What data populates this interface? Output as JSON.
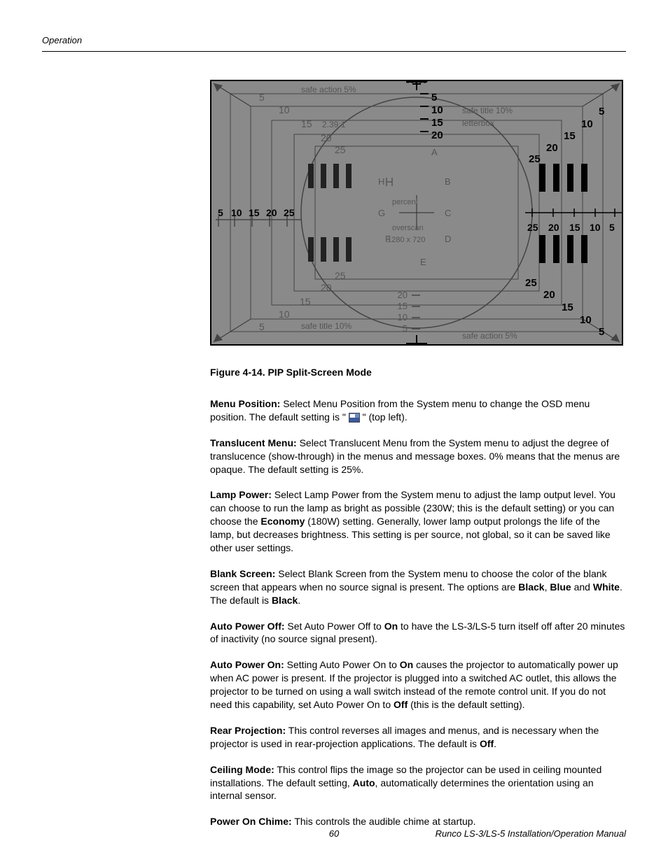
{
  "header": {
    "section": "Operation"
  },
  "figure": {
    "caption": "Figure 4-14. PIP Split-Screen Mode",
    "pattern": {
      "labels": {
        "safe_action": "safe action 5%",
        "safe_title": "safe title 10%",
        "aspect": "2.39:1",
        "letterbox": "letterbox",
        "percent": "percent",
        "overscan": "overscan",
        "resolution": "1280 x 720"
      },
      "scale": [
        "5",
        "10",
        "15",
        "20",
        "25"
      ],
      "grid_letters": [
        "A",
        "B",
        "C",
        "D",
        "E",
        "F",
        "G",
        "H"
      ]
    }
  },
  "sections": {
    "menu_position": {
      "title": "Menu Position:",
      "p1": " Select Menu Position from the System menu to change the OSD menu position. The default setting is \" ",
      "p2": " \" (top left)."
    },
    "translucent_menu": {
      "title": "Translucent Menu:",
      "text": " Select Translucent Menu from the System menu to adjust the degree of translucence (show-through) in the menus and message boxes. 0% means that the menus are opaque. The default setting is 25%."
    },
    "lamp_power": {
      "title": "Lamp Power:",
      "p1": " Select Lamp Power from the System menu to adjust the lamp output level. You can choose to run the lamp as bright as possible (230W; this is the default setting) or you can choose the ",
      "economy": "Economy",
      "p2": " (180W) setting. Generally, lower lamp output prolongs the life of the lamp, but decreases brightness. This setting is per source, not global, so it can be saved like other user settings."
    },
    "blank_screen": {
      "title": "Blank Screen:",
      "p1": " Select Blank Screen from the System menu to choose the color of the blank screen that appears when no source signal is present. The options are ",
      "opt1": "Black",
      "sep1": ", ",
      "opt2": "Blue",
      "p2": " and ",
      "opt3": "White",
      "p3": ". The default is ",
      "opt4": "Black",
      "p4": "."
    },
    "auto_power_off": {
      "title": "Auto Power Off:",
      "p1": " Set Auto Power Off to ",
      "on": "On",
      "p2": " to have the LS-3/LS-5 turn itself off after 20 minutes of inactivity (no source signal present)."
    },
    "auto_power_on": {
      "title": "Auto Power On:",
      "p1": " Setting Auto Power On to ",
      "on": "On",
      "p2": " causes the projector to automatically power up when AC power is present. If the projector is plugged into a switched AC outlet, this allows the projector to be turned on using a wall switch instead of the remote control unit. If you do not need this capability, set Auto Power On to ",
      "off": "Off",
      "p3": " (this is the default setting)."
    },
    "rear_projection": {
      "title": "Rear Projection:",
      "p1": " This control reverses all images and menus, and is necessary when the projector is used in rear-projection applications.  The default is ",
      "off": "Off",
      "p2": "."
    },
    "ceiling_mode": {
      "title": "Ceiling Mode:",
      "p1": " This control flips the image so the projector can be used in ceiling mounted installations. The default setting, ",
      "auto": "Auto",
      "p2": ", automatically determines the orientation using an internal sensor."
    },
    "power_on_chime": {
      "title": "Power On Chime:",
      "text": " This controls the audible chime at startup."
    }
  },
  "footer": {
    "page": "60",
    "manual": "Runco LS-3/LS-5 Installation/Operation Manual"
  }
}
